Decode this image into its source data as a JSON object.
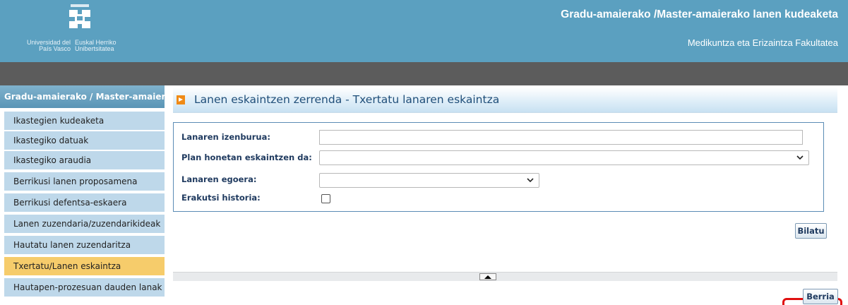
{
  "header": {
    "logo_text_es": "Universidad del País Vasco",
    "logo_text_eu": "Euskal Herriko Unibertsitatea",
    "app_title": "Gradu-amaierako /Master-amaierako lanen kudeaketa",
    "faculty": "Medikuntza eta Erizaintza Fakultatea"
  },
  "sidebar": {
    "heading": "Gradu-amaierako / Master-amaierako lanen kudeaketa",
    "items": [
      {
        "label": "Ikastegien kudeaketa"
      },
      {
        "label": "Ikastegiko datuak"
      },
      {
        "label": "Ikastegiko araudia"
      },
      {
        "label": "Berrikusi lanen proposamena"
      },
      {
        "label": "Berrikusi defentsa-eskaera"
      },
      {
        "label": "Lanen zuzendaria/zuzendarikideak"
      },
      {
        "label": "Hautatu lanen zuzendaritza"
      },
      {
        "label": "Txertatu/Lanen eskaintza",
        "active": true
      },
      {
        "label": "Hautapen-prozesuan dauden lanak"
      }
    ]
  },
  "main": {
    "title": "Lanen eskaintzen zerrenda - Txertatu lanaren eskaintza",
    "form": {
      "title_label": "Lanaren izenburua:",
      "title_value": "",
      "plan_label": "Plan honetan eskaintzen da:",
      "plan_value": "",
      "status_label": "Lanaren egoera:",
      "status_value": "",
      "history_label": "Erakutsi historia:",
      "history_checked": false
    },
    "search_button": "Bilatu",
    "new_button": "Berria"
  },
  "colors": {
    "header_bg": "#5ba0c0",
    "topbar_bg": "#5c5c5c",
    "sidebar_item_bg": "#bed8ea",
    "sidebar_active_bg": "#f6cc6b",
    "accent_arrow": "#f08a15",
    "title_text": "#1f4e79",
    "highlight": "#e01010"
  }
}
